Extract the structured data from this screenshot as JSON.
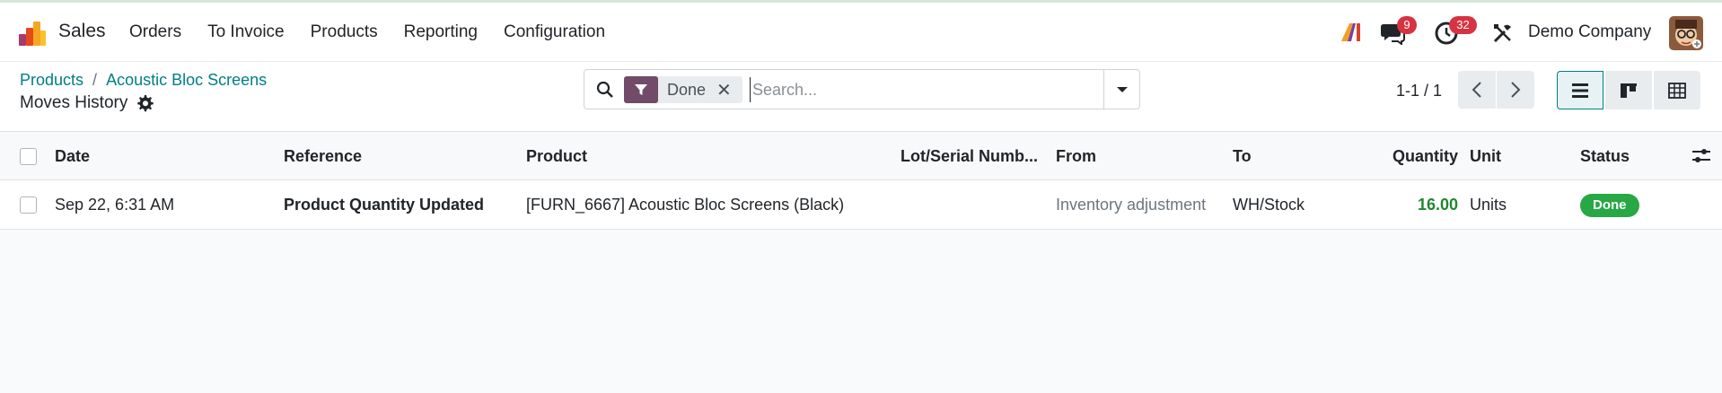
{
  "app": {
    "name": "Sales",
    "menu": [
      "Orders",
      "To Invoice",
      "Products",
      "Reporting",
      "Configuration"
    ]
  },
  "systray": {
    "messages_count": "9",
    "activities_count": "32",
    "company": "Demo Company"
  },
  "breadcrumb": {
    "items": [
      "Products",
      "Acoustic Bloc Screens"
    ],
    "separator": "/",
    "current": "Moves History"
  },
  "search": {
    "facet_label": "Done",
    "placeholder": "Search..."
  },
  "pager": {
    "value": "1-1 / 1"
  },
  "table": {
    "columns": [
      "Date",
      "Reference",
      "Product",
      "Lot/Serial Numb...",
      "From",
      "To",
      "Quantity",
      "Unit",
      "Status"
    ],
    "rows": [
      {
        "date": "Sep 22, 6:31 AM",
        "reference": "Product Quantity Updated",
        "product": "[FURN_6667] Acoustic Bloc Screens (Black)",
        "lot": "",
        "from": "Inventory adjustment",
        "to": "WH/Stock",
        "quantity": "16.00",
        "unit": "Units",
        "status": "Done"
      }
    ]
  },
  "colors": {
    "brand": "#714b67",
    "link": "#017e84",
    "reference": "#9b7214",
    "done": "#28a745",
    "badge": "#d63343"
  },
  "icons": [
    "search-icon",
    "filter-icon",
    "close-icon",
    "caret-down-icon",
    "chevron-left-icon",
    "chevron-right-icon",
    "list-view-icon",
    "kanban-view-icon",
    "pivot-view-icon",
    "gear-icon",
    "chat-icon",
    "clock-icon",
    "tools-icon",
    "column-options-icon"
  ]
}
